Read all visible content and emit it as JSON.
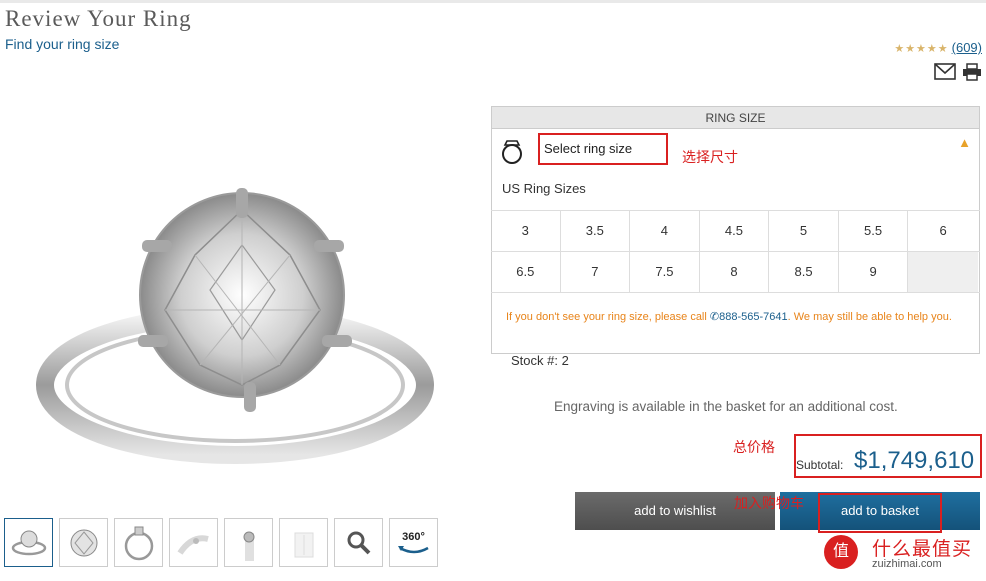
{
  "header": {
    "title": "Review Your Ring",
    "subtitle_link": "Find your ring size",
    "review_count": "(609)",
    "rating_stars": 5
  },
  "product": {
    "image_icon": "diamond-solitaire-ring-image",
    "thumbnails": [
      {
        "icon": "ring-side-view-icon"
      },
      {
        "icon": "diamond-top-view-icon"
      },
      {
        "icon": "ring-profile-icon"
      },
      {
        "icon": "hand-model-icon"
      },
      {
        "icon": "ring-on-finger-icon"
      },
      {
        "icon": "ring-box-icon"
      },
      {
        "icon": "zoom-icon"
      },
      {
        "label": "360°",
        "icon": "rotate-360-icon"
      }
    ]
  },
  "ring_size": {
    "header": "RING SIZE",
    "select_label": "Select ring size",
    "annotation_select": "选择尺寸",
    "us_sizes_label": "US Ring Sizes",
    "rows": [
      [
        "3",
        "3.5",
        "4",
        "4.5",
        "5",
        "5.5",
        "6"
      ],
      [
        "6.5",
        "7",
        "7.5",
        "8",
        "8.5",
        "9",
        ""
      ]
    ],
    "notice_before": "If you don't see your ring size, please call ",
    "phone": "888-565-7641",
    "notice_after": ". We may still be able to help you."
  },
  "stock": {
    "text": "Stock #: 2"
  },
  "engraving_text": "Engraving is available in the basket for an additional cost.",
  "pricing": {
    "annotation_total": "总价格",
    "subtotal_label": "Subtotal:",
    "subtotal_value": "$1,749,610"
  },
  "actions": {
    "wishlist": "add to wishlist",
    "basket": "add to basket",
    "annotation_add": "加入购物车"
  },
  "watermark": {
    "badge": "值",
    "name": "什么最值买",
    "url": "zuizhimai.com"
  },
  "colors": {
    "accent": "#1b5f8c",
    "annotation_red": "#d92020",
    "star": "#d9b46a",
    "notice_orange": "#e8841a"
  }
}
